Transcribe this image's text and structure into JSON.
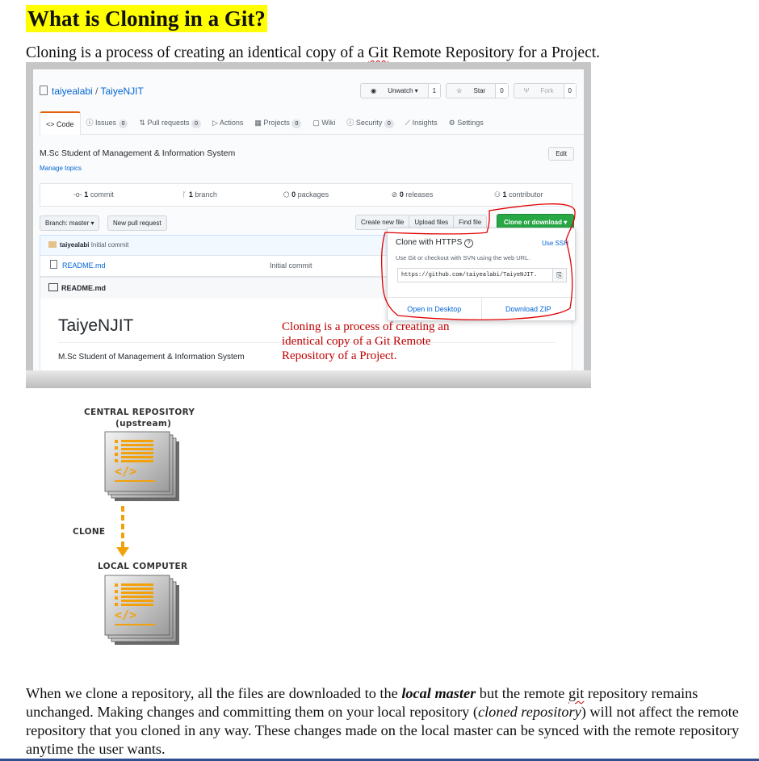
{
  "heading": "What is Cloning in a Git?",
  "intro": {
    "before": "Cloning is a process of creating an identical copy of a ",
    "git": "Git",
    "after": " Remote Repository for a Project."
  },
  "github": {
    "repo_owner": "taiyealabi",
    "repo_sep": " / ",
    "repo_name": "TaiyeNJIT",
    "watch_label": "Unwatch ▾",
    "watch_count": "1",
    "star_label": "Star",
    "star_count": "0",
    "fork_label": "Fork",
    "fork_count": "0",
    "tabs": [
      {
        "label": "<> Code",
        "count": ""
      },
      {
        "label": "ⓘ Issues",
        "count": "0"
      },
      {
        "label": "⇅ Pull requests",
        "count": "0"
      },
      {
        "label": "▷ Actions",
        "count": ""
      },
      {
        "label": "▦ Projects",
        "count": "0"
      },
      {
        "label": "▢ Wiki",
        "count": ""
      },
      {
        "label": "ⓘ Security",
        "count": "0"
      },
      {
        "label": "⟋ Insights",
        "count": ""
      },
      {
        "label": "⚙ Settings",
        "count": ""
      }
    ],
    "description": "M.Sc Student of Management & Information System",
    "manage_topics": "Manage topics",
    "edit_label": "Edit",
    "stats": [
      {
        "icon": "-o-",
        "num": "1",
        "label": " commit"
      },
      {
        "icon": "ᚴ",
        "num": "1",
        "label": " branch"
      },
      {
        "icon": "⬡",
        "num": "0",
        "label": " packages"
      },
      {
        "icon": "⊘",
        "num": "0",
        "label": " releases"
      },
      {
        "icon": "⚇",
        "num": "1",
        "label": " contributor"
      }
    ],
    "branch_label": "Branch: master ▾",
    "new_pr_label": "New pull request",
    "create_file": "Create new file",
    "upload_files": "Upload files",
    "find_file": "Find file",
    "clone_label": "Clone or download ▾",
    "commit_author": "taiyealabi",
    "commit_msg": "Initial commit",
    "file_name": "README.md",
    "file_msg": "Initial commit",
    "readme_head": "README.md",
    "readme_title": "TaiyeNJIT",
    "readme_desc": "M.Sc Student of Management & Information System",
    "popup": {
      "title": "Clone with HTTPS",
      "use_ssh": "Use SSH",
      "sub": "Use Git or checkout with SVN using the web URL.",
      "url": "https://github.com/taiyealabi/TaiyeNJIT.",
      "open_desktop": "Open in Desktop",
      "download_zip": "Download ZIP"
    },
    "overlay_note": "Cloning is a process of creating an identical copy of a Git Remote Repository of a Project."
  },
  "diagram": {
    "central_line1": "CENTRAL REPOSITORY",
    "central_line2": "(upstream)",
    "clone_label": "CLONE",
    "local_label": "LOCAL COMPUTER",
    "code_glyph": "</>"
  },
  "body": {
    "p1": "When we clone a repository, all the files are downloaded to the ",
    "local_master": "local master",
    "p2": " but the remote ",
    "git": "git",
    "p3": " repository remains unchanged. Making changes and committing them on your local repository (",
    "cloned_repo": "cloned repository",
    "p4": ") will not affect the remote repository that you cloned in any way. These changes made on the local master can be synced with the remote repository anytime the user wants."
  },
  "colors": {
    "highlight": "#ffff00",
    "annotation_red": "#c00000",
    "github_green": "#28a745",
    "link_blue": "#0366d6",
    "diagram_orange": "#f2a10b"
  }
}
